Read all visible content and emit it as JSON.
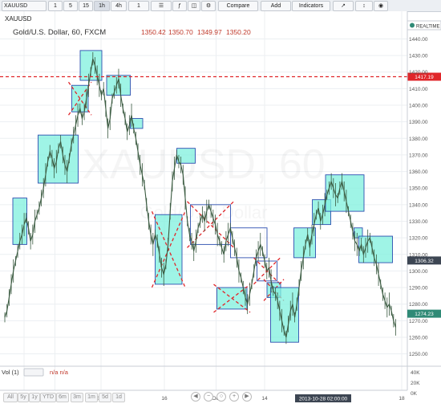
{
  "toolbar": {
    "symbol": "XAUUSD",
    "intervals": [
      "1",
      "5",
      "15",
      "1h",
      "4h",
      "1"
    ],
    "compare_label": "Compare",
    "add_label": "Add",
    "indicators_label": "Indicators",
    "realtime_label": "REALTIME"
  },
  "header": {
    "title": "Gold/U.S. Dollar, 60, FXCM",
    "ohlc": [
      "1350.42",
      "1350.70",
      "1349.97",
      "1350.20"
    ]
  },
  "watermark": {
    "line1": "XAUUSD, 60",
    "line2": "Gold/U.S. Dollar"
  },
  "hline": {
    "price": 1417.19,
    "label": "1417.19",
    "color": "#e0262a"
  },
  "price_badges": [
    {
      "value": 1306.32,
      "label": "1306.32",
      "color": "#3d4653"
    },
    {
      "value": 1274.23,
      "label": "1274.23",
      "color": "#2f8a76"
    }
  ],
  "volume": {
    "label": "Vol (1)",
    "values": "n/a n/a",
    "axis_labels": [
      "40K",
      "20K",
      "0K"
    ]
  },
  "ranges": [
    "All",
    "5y",
    "1y",
    "YTD",
    "6m",
    "3m",
    "1m",
    "5d",
    "1d"
  ],
  "nav_icons": [
    "scroll-left-icon",
    "zoom-out-icon",
    "reset-icon",
    "zoom-in-icon",
    "scroll-right-icon"
  ],
  "time_stamp": "2013-10-28 02:00:00",
  "colors": {
    "up_box": "#7ff0dd",
    "box_border": "#2d4fb0",
    "cross": "#e0262a",
    "candle": "#3a5a40"
  },
  "chart_data": {
    "type": "line",
    "title": "Gold/U.S. Dollar, 60, FXCM",
    "y_ticks": [
      1250,
      1260,
      1270,
      1280,
      1290,
      1300,
      1310,
      1320,
      1330,
      1340,
      1350,
      1360,
      1370,
      1380,
      1390,
      1400,
      1410,
      1420,
      1430,
      1440
    ],
    "x_ticks": [
      "12",
      "21",
      "Sep",
      "16",
      "Oct",
      "14",
      "18"
    ],
    "ylim": [
      1244,
      1447
    ],
    "series": [
      {
        "values": [
          1272,
          1276,
          1284,
          1292,
          1300,
          1306,
          1312,
          1318,
          1322,
          1328,
          1332,
          1326,
          1318,
          1322,
          1330,
          1334,
          1338,
          1344,
          1350,
          1358,
          1366,
          1372,
          1368,
          1362,
          1366,
          1374,
          1378,
          1370,
          1364,
          1360,
          1368,
          1376,
          1382,
          1388,
          1394,
          1398,
          1392,
          1396,
          1404,
          1412,
          1420,
          1428,
          1424,
          1418,
          1412,
          1406,
          1410,
          1398,
          1386,
          1392,
          1404,
          1408,
          1412,
          1416,
          1406,
          1398,
          1392,
          1384,
          1388,
          1394,
          1386,
          1380,
          1372,
          1364,
          1358,
          1352,
          1340,
          1330,
          1322,
          1316,
          1322,
          1318,
          1310,
          1302,
          1298,
          1304,
          1316,
          1336,
          1354,
          1362,
          1370,
          1366,
          1364,
          1358,
          1344,
          1330,
          1322,
          1318,
          1312,
          1318,
          1326,
          1330,
          1334,
          1330,
          1336,
          1340,
          1336,
          1332,
          1328,
          1322,
          1318,
          1314,
          1310,
          1318,
          1322,
          1326,
          1320,
          1314,
          1308,
          1300,
          1296,
          1290,
          1284,
          1280,
          1286,
          1292,
          1300,
          1308,
          1312,
          1316,
          1312,
          1306,
          1300,
          1302,
          1294,
          1288,
          1286,
          1282,
          1276,
          1270,
          1264,
          1260,
          1268,
          1276,
          1280,
          1272,
          1280,
          1290,
          1300,
          1308,
          1316,
          1322,
          1314,
          1322,
          1328,
          1334,
          1338,
          1330,
          1334,
          1340,
          1346,
          1350,
          1354,
          1350,
          1346,
          1344,
          1350,
          1354,
          1348,
          1342,
          1336,
          1330,
          1324,
          1318,
          1316,
          1312,
          1316,
          1310,
          1314,
          1318,
          1320,
          1314,
          1308,
          1304,
          1298,
          1292,
          1286,
          1282,
          1278,
          1280,
          1276,
          1270,
          1266
        ]
      }
    ],
    "annotations": [
      {
        "type": "box",
        "t": [
          0.02,
          0.055
        ],
        "p": [
          1316,
          1344
        ],
        "fill": "#7ff0dd"
      },
      {
        "type": "box",
        "t": [
          0.083,
          0.183
        ],
        "p": [
          1353,
          1382
        ],
        "fill": "#7ff0dd"
      },
      {
        "type": "box",
        "t": [
          0.167,
          0.208
        ],
        "p": [
          1396,
          1412
        ],
        "fill": "#7ff0dd",
        "cross": true
      },
      {
        "type": "box",
        "t": [
          0.188,
          0.242
        ],
        "p": [
          1415,
          1433
        ],
        "fill": "#7ff0dd"
      },
      {
        "type": "box",
        "t": [
          0.254,
          0.313
        ],
        "p": [
          1406,
          1418
        ],
        "fill": "#7ff0dd"
      },
      {
        "type": "box",
        "t": [
          0.313,
          0.344
        ],
        "p": [
          1386,
          1392
        ],
        "fill": "#7ff0dd"
      },
      {
        "type": "box",
        "t": [
          0.375,
          0.442
        ],
        "p": [
          1292,
          1334
        ],
        "fill": "#7ff0dd",
        "cross": true
      },
      {
        "type": "box",
        "t": [
          0.429,
          0.475
        ],
        "p": [
          1365,
          1374
        ],
        "fill": "#7ff0dd"
      },
      {
        "type": "box",
        "t": [
          0.463,
          0.563
        ],
        "p": [
          1316,
          1340
        ],
        "fill": "none",
        "cross": true
      },
      {
        "type": "box",
        "t": [
          0.563,
          0.654
        ],
        "p": [
          1308,
          1326
        ],
        "fill": "none"
      },
      {
        "type": "box",
        "t": [
          0.529,
          0.604
        ],
        "p": [
          1277,
          1290
        ],
        "fill": "#7ff0dd",
        "cross": true
      },
      {
        "type": "box",
        "t": [
          0.629,
          0.679
        ],
        "p": [
          1294,
          1306
        ],
        "fill": "none",
        "cross": true
      },
      {
        "type": "box",
        "t": [
          0.654,
          0.688
        ],
        "p": [
          1284,
          1293
        ],
        "fill": "#7ff0dd",
        "cross": true
      },
      {
        "type": "box",
        "t": [
          0.663,
          0.733
        ],
        "p": [
          1257,
          1290
        ],
        "fill": "#7ff0dd"
      },
      {
        "type": "box",
        "t": [
          0.721,
          0.775
        ],
        "p": [
          1308,
          1326
        ],
        "fill": "#7ff0dd"
      },
      {
        "type": "box",
        "t": [
          0.767,
          0.813
        ],
        "p": [
          1328,
          1343
        ],
        "fill": "#7ff0dd"
      },
      {
        "type": "box",
        "t": [
          0.8,
          0.896
        ],
        "p": [
          1336,
          1358
        ],
        "fill": "#7ff0dd"
      },
      {
        "type": "box",
        "t": [
          0.871,
          0.892
        ],
        "p": [
          1320,
          1326
        ],
        "fill": "#7ff0dd"
      },
      {
        "type": "box",
        "t": [
          0.883,
          0.967
        ],
        "p": [
          1305,
          1321
        ],
        "fill": "#7ff0dd"
      }
    ]
  }
}
